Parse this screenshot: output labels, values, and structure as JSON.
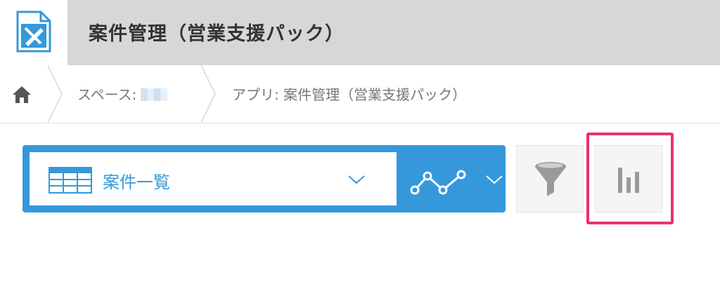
{
  "header": {
    "title": "案件管理（営業支援パック）",
    "app_icon": "app-pencil-icon"
  },
  "breadcrumb": {
    "home_icon": "home-icon",
    "space_label": "スペース:",
    "app_label": "アプリ: 案件管理（営業支援パック）"
  },
  "toolbar": {
    "view_name": "案件一覧",
    "view_icon": "table-icon",
    "graph_menu_icon": "line-graph-icon",
    "filter_icon": "filter-icon",
    "graph_button_icon": "bar-chart-icon"
  },
  "colors": {
    "accent": "#3498db",
    "header_bg": "#d7d7d7",
    "highlight": "#e8336d",
    "text": "#333333",
    "muted_text": "#777777"
  }
}
